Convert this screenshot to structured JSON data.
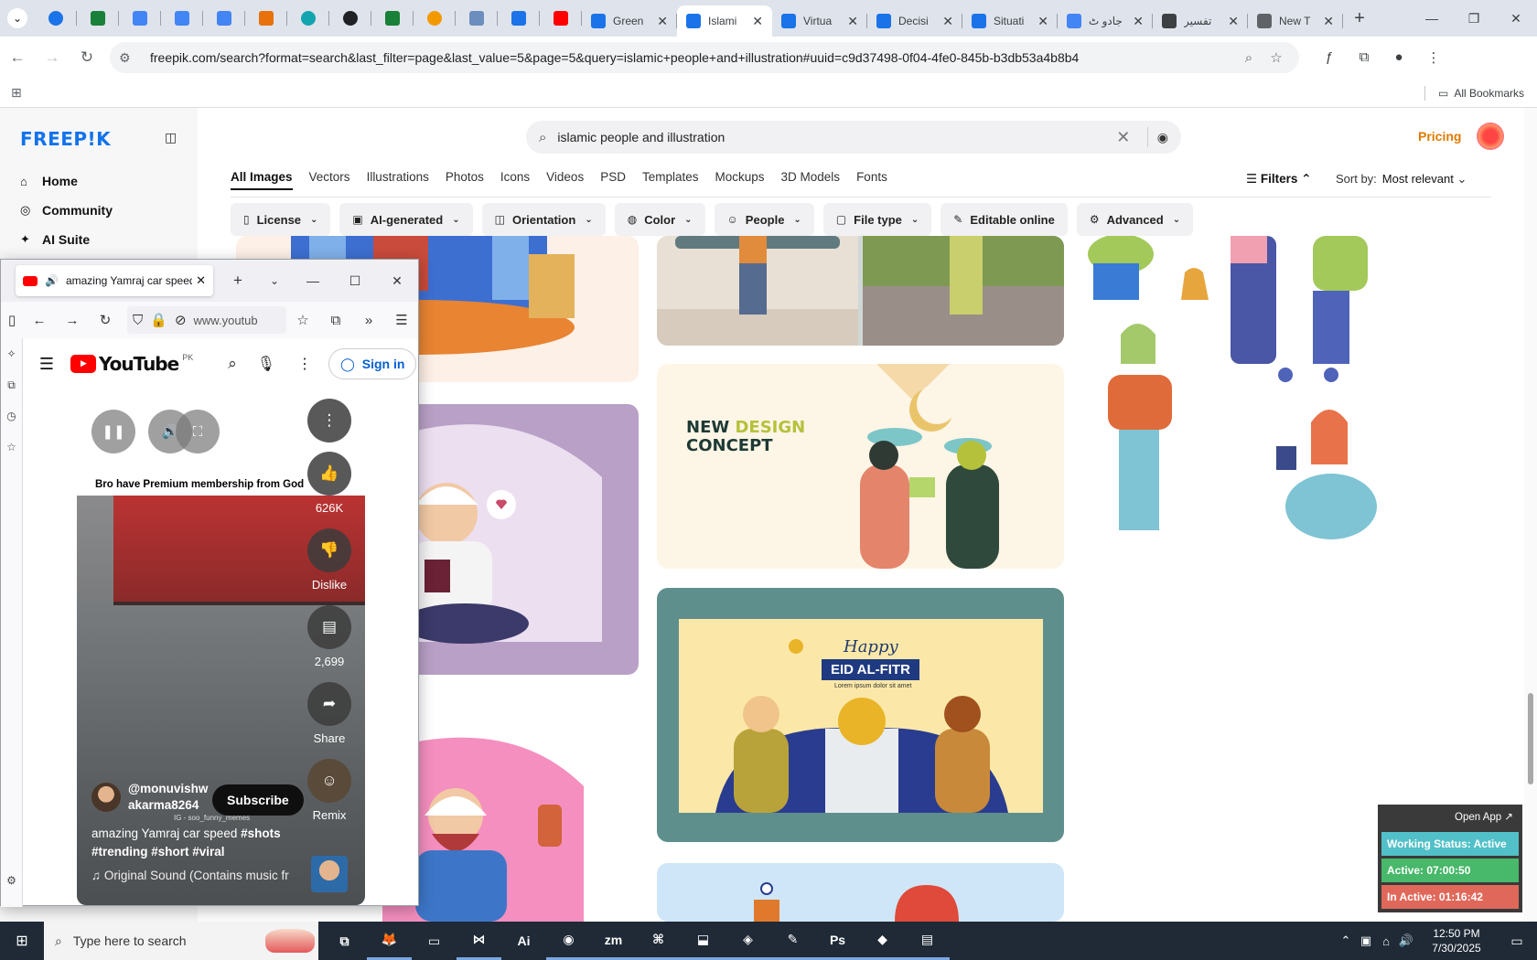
{
  "browser": {
    "tabs": [
      {
        "label": "Green",
        "color": "#1a73e8"
      },
      {
        "label": "Islami",
        "color": "#1a73e8",
        "active": true
      },
      {
        "label": "Virtua",
        "color": "#1a73e8"
      },
      {
        "label": "Decisi",
        "color": "#1a73e8"
      },
      {
        "label": "Situati",
        "color": "#1a73e8"
      },
      {
        "label": "جادو ٹ",
        "color": "#4285f4"
      },
      {
        "label": "تفسیر",
        "color": "#3c4043"
      },
      {
        "label": "New T",
        "color": "#5f6368"
      }
    ],
    "tab_close": "✕",
    "new_tab": "+",
    "url": "freepik.com/search?format=search&last_filter=page&last_value=5&page=5&query=islamic+people+and+illustration#uuid=c9d37498-0f04-4fe0-845b-b3db53a4b8b4",
    "all_bookmarks": "All Bookmarks"
  },
  "freepik": {
    "logo": "FREEP!K",
    "nav": [
      {
        "icon": "⌂",
        "label": "Home"
      },
      {
        "icon": "◎",
        "label": "Community"
      },
      {
        "icon": "✦",
        "label": "AI Suite"
      }
    ],
    "search_value": "islamic people and illustration",
    "pricing": "Pricing",
    "type_tabs": [
      "All Images",
      "Vectors",
      "Illustrations",
      "Photos",
      "Icons",
      "Videos",
      "PSD",
      "Templates",
      "Mockups",
      "3D Models",
      "Fonts"
    ],
    "filters_label": "Filters",
    "sort_label": "Sort by:",
    "sort_value": "Most relevant",
    "chips": [
      {
        "icon": "▯",
        "label": "License"
      },
      {
        "icon": "▣",
        "label": "AI-generated"
      },
      {
        "icon": "◫",
        "label": "Orientation"
      },
      {
        "icon": "◍",
        "label": "Color"
      },
      {
        "icon": "☺",
        "label": "People"
      },
      {
        "icon": "▢",
        "label": "File type"
      },
      {
        "icon": "✎",
        "label": "Editable online",
        "no_dropdown": true
      },
      {
        "icon": "⚙",
        "label": "Advanced"
      }
    ],
    "concept_line1": "NEW ",
    "concept_hl": "DESIGN",
    "concept_line2": "CONCEPT",
    "eid_happy": "Happy",
    "eid_title": "EID AL-FITR",
    "eid_sub": "Lorem ipsum dolor sit amet"
  },
  "firefox": {
    "tab_title": "amazing Yamraj car speed #",
    "url": "www.youtub"
  },
  "youtube": {
    "logo": "YouTube",
    "country": "PK",
    "sign_in": "Sign in",
    "top_caption": "Bro have Premium membership from God",
    "likes": "626K",
    "dislike": "Dislike",
    "comments": "2,699",
    "share": "Share",
    "remix": "Remix",
    "channel": "@monuvishwakarma8264",
    "subscribe": "Subscribe",
    "ig_tag": "IG - soo_funny_memes",
    "title_plain": "amazing Yamraj car speed ",
    "title_tags": "#shots #trending #short #viral",
    "sound": "Original Sound (Contains music fr"
  },
  "tracker": {
    "open_app": "Open App ↗",
    "working": "Working Status: Active",
    "active": "Active: 07:00:50",
    "inactive": "In Active: 01:16:42",
    "colors": {
      "working": "#52c0c8",
      "active": "#48b86a",
      "inactive": "#e0685a"
    }
  },
  "taskbar": {
    "search_placeholder": "Type here to search",
    "time": "12:50 PM",
    "date": "7/30/2025",
    "apps": [
      "⧉",
      "🦊",
      "▭",
      "⋈",
      "Ai",
      "◉",
      "zm",
      "⌘",
      "⬓",
      "◈",
      "✎",
      "Ps",
      "◆",
      "▤"
    ]
  }
}
